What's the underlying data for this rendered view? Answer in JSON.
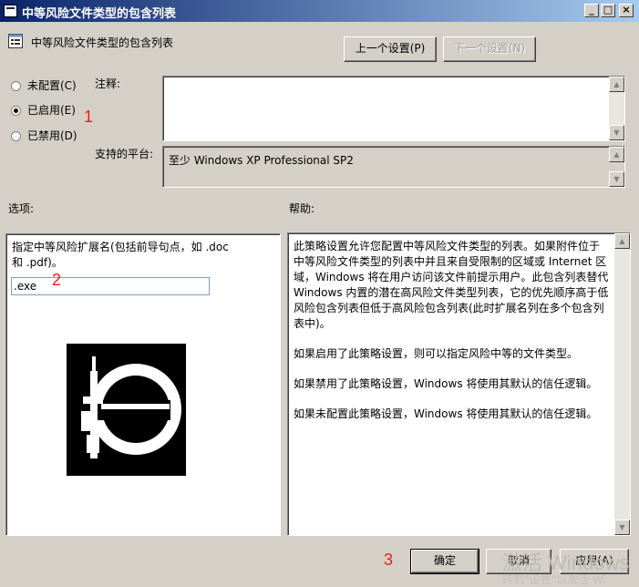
{
  "window": {
    "title": "中等风险文件类型的包含列表",
    "minimize_glyph": "_",
    "maximize_glyph": "□",
    "close_glyph": "×"
  },
  "header": {
    "policy_name": "中等风险文件类型的包含列表",
    "prev_button": "上一个设置(P)",
    "next_button": "下一个设置(N)"
  },
  "state": {
    "options": [
      {
        "label": "未配置(C)",
        "selected": false
      },
      {
        "label": "已启用(E)",
        "selected": true
      },
      {
        "label": "已禁用(D)",
        "selected": false
      }
    ]
  },
  "comment": {
    "label": "注释:",
    "value": ""
  },
  "platform": {
    "label": "支持的平台:",
    "value": "至少 Windows XP Professional SP2"
  },
  "options_panel": {
    "label": "选项:",
    "description": "指定中等风险扩展名(包括前导句点，如  .doc 和 .pdf)。",
    "input_value": ".exe"
  },
  "help_panel": {
    "label": "帮助:",
    "paragraphs": [
      "此策略设置允许您配置中等风险文件类型的列表。如果附件位于中等风险文件类型的列表中并且来自受限制的区域或 Internet 区域，Windows 将在用户访问该文件前提示用户。此包含列表替代 Windows 内置的潜在高风险文件类型列表，它的优先顺序高于低风险包含列表但低于高风险包含列表(此时扩展名列在多个包含列表中)。",
      "如果启用了此策略设置，则可以指定风险中等的文件类型。",
      "如果禁用了此策略设置，Windows 将使用其默认的信任逻辑。",
      "如果未配置此策略设置，Windows 将使用其默认的信任逻辑。"
    ]
  },
  "footer": {
    "ok_button": "确定",
    "cancel_button": "取消",
    "apply_button": "应用(A)"
  },
  "annotations": [
    "1",
    "2",
    "3"
  ],
  "watermark": {
    "line1": "激活 Windows",
    "line2": "转到\"设置\"以激活 Wi"
  },
  "colors": {
    "titlebar_start": "#0a246a",
    "titlebar_end": "#a6caf0",
    "dialog_bg": "#d4d0c8",
    "annotation_red": "#e8201c"
  },
  "icons": {
    "policy": "policy-setting-icon",
    "logo": "stylized-logo-icon",
    "scroll_up": "scroll-up-arrow-icon",
    "scroll_down": "scroll-down-arrow-icon"
  }
}
